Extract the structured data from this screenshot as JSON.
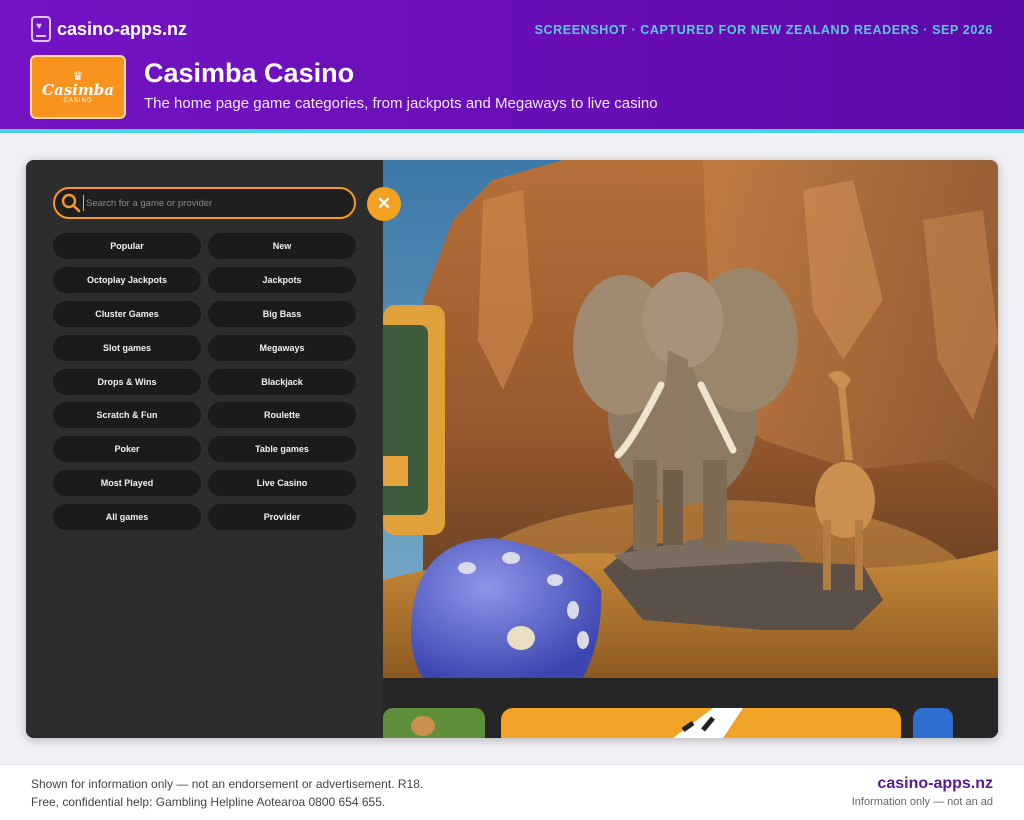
{
  "header": {
    "site_name": "casino-apps.nz",
    "captured": "SCREENSHOT · CAPTURED FOR NEW ZEALAND READERS · SEP 2026",
    "title": "Casimba Casino",
    "subtitle": "The home page game categories, from jackpots and Megaways to live casino",
    "logo_text": "Casimba",
    "logo_sub": "CASINO"
  },
  "screen": {
    "search_placeholder": "Search for a game or provider",
    "close_label": "✕",
    "categories": [
      [
        "Popular",
        "New"
      ],
      [
        "Octoplay Jackpots",
        "Jackpots"
      ],
      [
        "Cluster Games",
        "Big Bass"
      ],
      [
        "Slot games",
        "Megaways"
      ],
      [
        "Drops & Wins",
        "Blackjack"
      ],
      [
        "Scratch & Fun",
        "Roulette"
      ],
      [
        "Poker",
        "Table games"
      ],
      [
        "Most Played",
        "Live Casino"
      ],
      [
        "All games",
        "Provider"
      ]
    ]
  },
  "footer": {
    "disclaimer": "Shown for information only — not an endorsement or advertisement. R18.",
    "helpline": "Free, confidential help: Gambling Helpline Aotearoa 0800 654 655.",
    "site_name": "casino-apps.nz",
    "tagline": "Information only — not an ad"
  },
  "colors": {
    "header": "#6a0fb8",
    "accent_line": "#45d4e8",
    "search_border": "#f39a2b",
    "close_button": "#f3a122",
    "footer_site": "#5b1a8a"
  },
  "icons": {
    "site": "phone-heart-icon",
    "search": "search-icon",
    "close": "close-icon"
  }
}
